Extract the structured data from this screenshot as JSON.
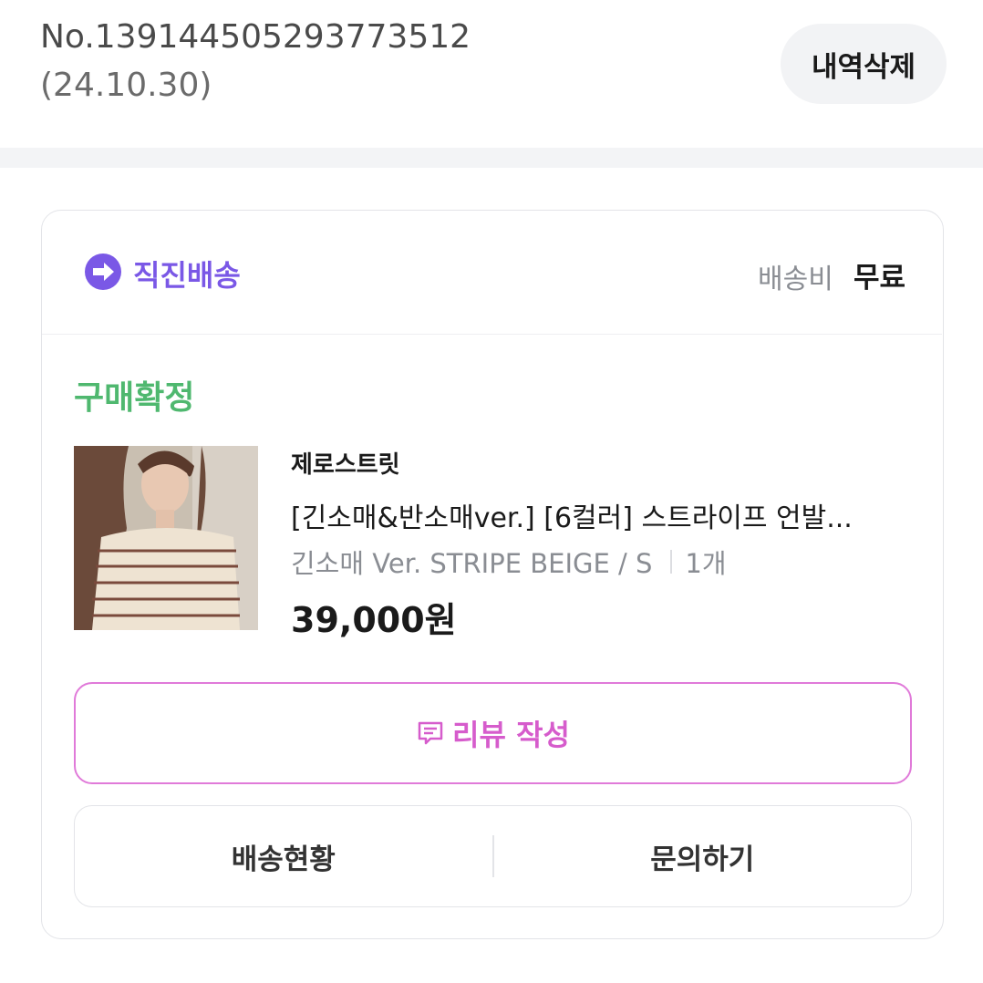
{
  "order": {
    "number": "No.139144505293773512",
    "date": "(24.10.30)",
    "delete_label": "내역삭제"
  },
  "shipping": {
    "type_label": "직진배송",
    "fee_label": "배송비",
    "fee_value": "무료",
    "icon": "arrow-circle-icon"
  },
  "item": {
    "status": "구매확정",
    "brand": "제로스트릿",
    "name": "[긴소매&반소매ver.] [6컬러] 스트라이프 언발...",
    "option": "긴소매 Ver. STRIPE BEIGE / S",
    "quantity": "1개",
    "price": "39,000원",
    "thumbnail": "product-photo"
  },
  "actions": {
    "review_label": "리뷰 작성",
    "shipping_status_label": "배송현황",
    "inquiry_label": "문의하기"
  },
  "colors": {
    "shipping_accent": "#7a58e6",
    "status_green": "#4fb86f",
    "review_pink": "#d65ccc"
  }
}
